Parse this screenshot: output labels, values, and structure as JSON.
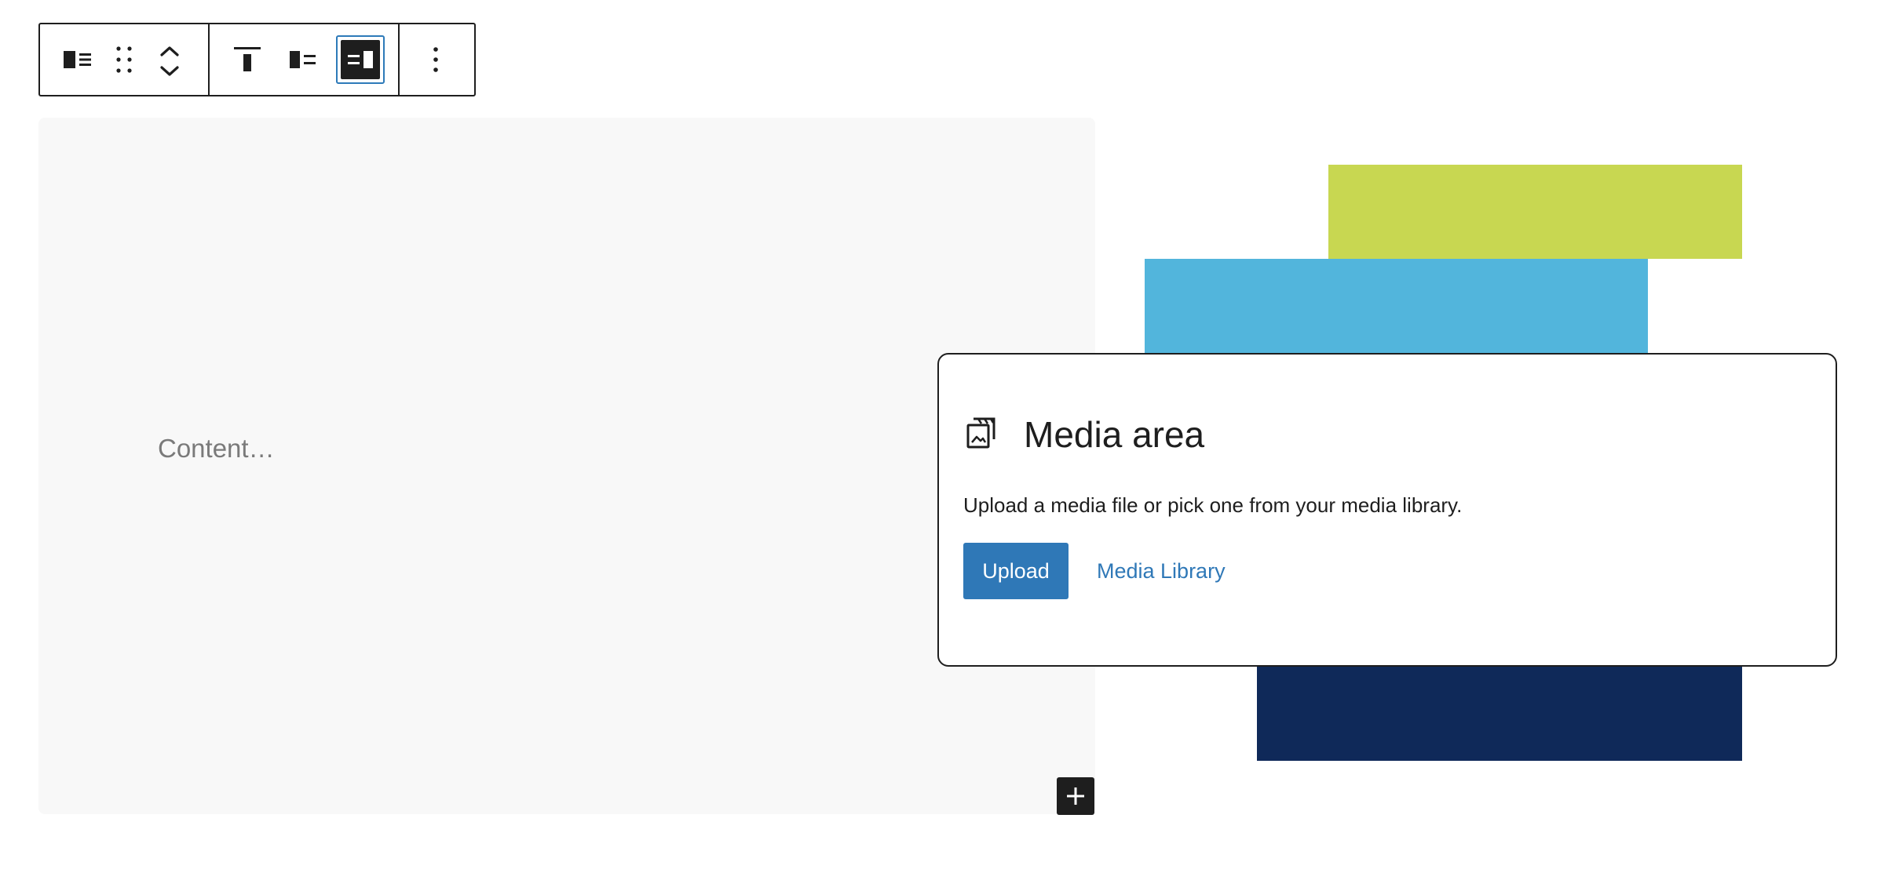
{
  "toolbar": {
    "buttons": [
      {
        "name": "media-text-block-icon",
        "label": "Media & Text"
      },
      {
        "name": "drag-handle-icon",
        "label": "Drag"
      },
      {
        "name": "move-up-icon",
        "label": "Move up"
      },
      {
        "name": "move-down-icon",
        "label": "Move down"
      },
      {
        "name": "align-top-icon",
        "label": "Change vertical alignment"
      },
      {
        "name": "media-left-icon",
        "label": "Show media on left"
      },
      {
        "name": "media-right-icon",
        "label": "Show media on right",
        "active": true
      },
      {
        "name": "more-options-icon",
        "label": "Options"
      }
    ],
    "active_color": "#2d7ab9"
  },
  "content": {
    "placeholder": "Content…"
  },
  "decor": {
    "colors": {
      "lime": "#c8d751",
      "blue": "#52b5dc",
      "navy": "#0f2959"
    }
  },
  "media": {
    "icon": "media-icon",
    "title": "Media area",
    "instructions": "Upload a media file or pick one from your media library.",
    "upload_label": "Upload",
    "library_label": "Media Library",
    "accent_color": "#2f78b7"
  },
  "add_block": {
    "icon": "plus-icon"
  }
}
